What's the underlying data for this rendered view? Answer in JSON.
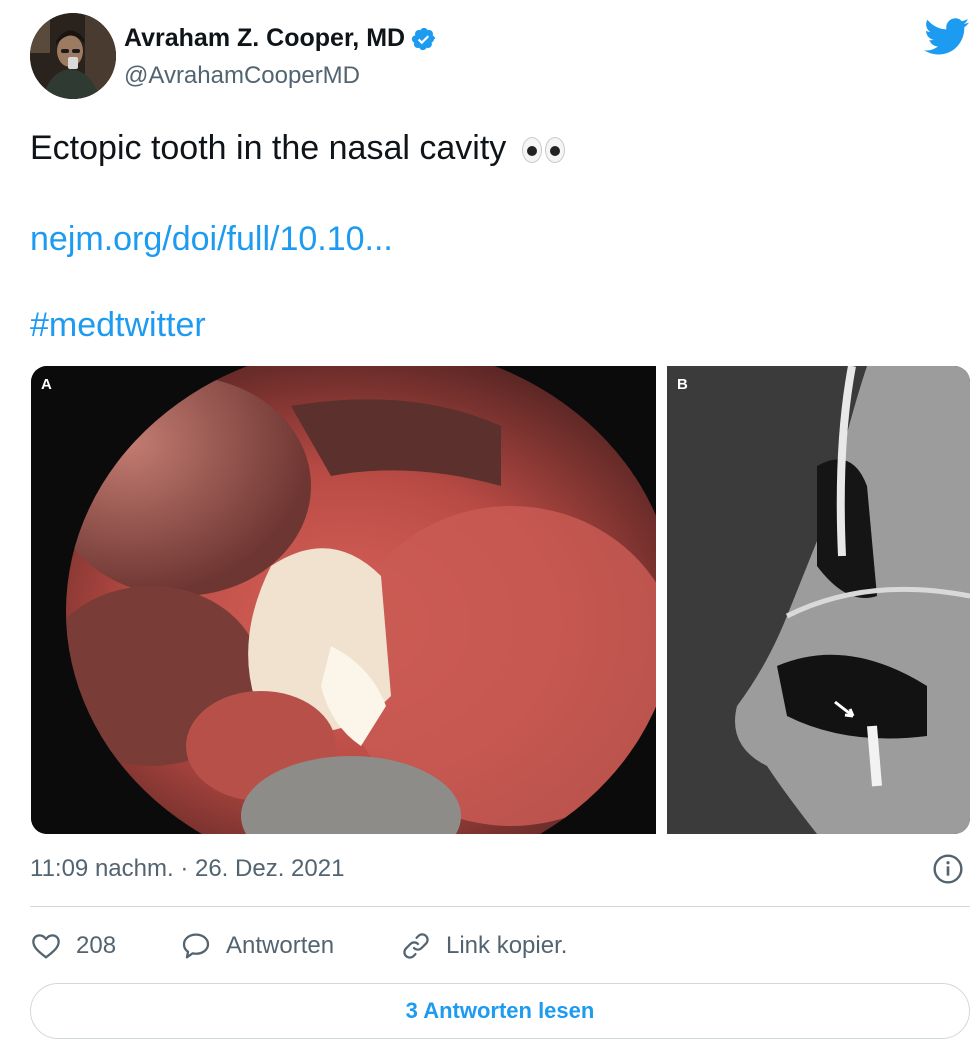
{
  "author": {
    "name": "Avraham Z. Cooper, MD",
    "handle": "@AvrahamCooperMD",
    "verified": true
  },
  "tweet": {
    "text": "Ectopic tooth in the nasal cavity",
    "emoji": "eyes",
    "link": "nejm.org/doi/full/10.10...",
    "hashtag": "#medtwitter"
  },
  "media": {
    "panels": [
      {
        "label": "A"
      },
      {
        "label": "B"
      }
    ]
  },
  "meta": {
    "timestamp": "11:09 nachm. · 26. Dez. 2021"
  },
  "actions": {
    "likes_count": "208",
    "reply_label": "Antworten",
    "copy_link_label": "Link kopier."
  },
  "read_replies_label": "3 Antworten lesen",
  "colors": {
    "accent": "#1d9bf0",
    "text": "#0f1419",
    "secondary": "#536471",
    "border": "#cfd9de"
  },
  "icons": [
    "verified-badge-icon",
    "twitter-bird-icon",
    "info-icon",
    "heart-icon",
    "speech-bubble-icon",
    "link-icon",
    "eyes-emoji-icon"
  ]
}
